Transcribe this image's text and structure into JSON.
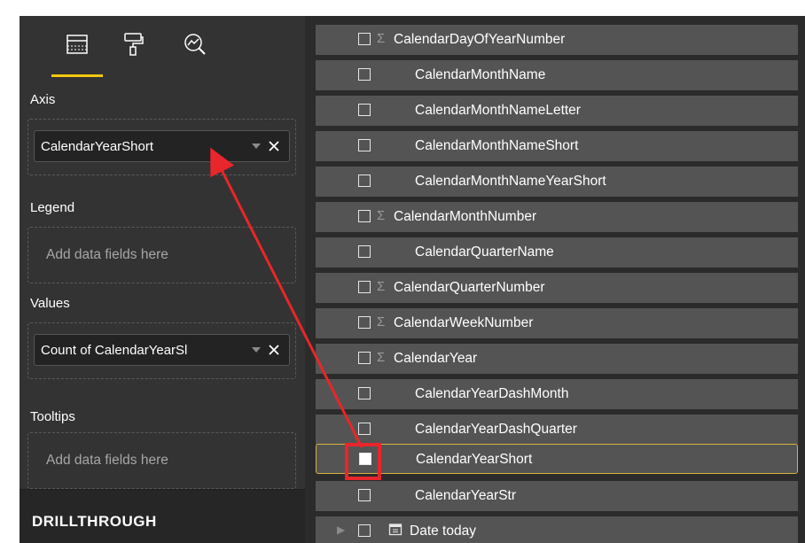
{
  "tabs": [
    {
      "name": "fields-icon"
    },
    {
      "name": "format-paint-roller-icon"
    },
    {
      "name": "analytics-magnifier-icon"
    }
  ],
  "wells": {
    "axis": {
      "label": "Axis",
      "field": "CalendarYearShort"
    },
    "legend": {
      "label": "Legend",
      "placeholder": "Add data fields here"
    },
    "values": {
      "label": "Values",
      "field": "Count of CalendarYearSl"
    },
    "tooltips": {
      "label": "Tooltips",
      "placeholder": "Add data fields here"
    }
  },
  "drillthrough": {
    "label": "DRILLTHROUGH"
  },
  "fields": [
    {
      "label": "CalendarDayOfYearNumber",
      "sigma": "Σ"
    },
    {
      "label": "CalendarMonthName"
    },
    {
      "label": "CalendarMonthNameLetter"
    },
    {
      "label": "CalendarMonthNameShort"
    },
    {
      "label": "CalendarMonthNameYearShort"
    },
    {
      "label": "CalendarMonthNumber",
      "sigma": "Σ"
    },
    {
      "label": "CalendarQuarterName"
    },
    {
      "label": "CalendarQuarterNumber",
      "sigma": "Σ"
    },
    {
      "label": "CalendarWeekNumber",
      "sigma": "Σ"
    },
    {
      "label": "CalendarYear",
      "sigma": "Σ"
    },
    {
      "label": "CalendarYearDashMonth"
    },
    {
      "label": "CalendarYearDashQuarter"
    },
    {
      "label": "CalendarYearShort",
      "selected": true,
      "checked": true
    },
    {
      "label": "CalendarYearStr"
    },
    {
      "label": "Date today",
      "icon": "calendar-icon",
      "expandable": true
    }
  ],
  "colors": {
    "accent_underline": "#f2c80f",
    "annotation_red": "#e8262b",
    "selected_border": "#d6b23a"
  }
}
